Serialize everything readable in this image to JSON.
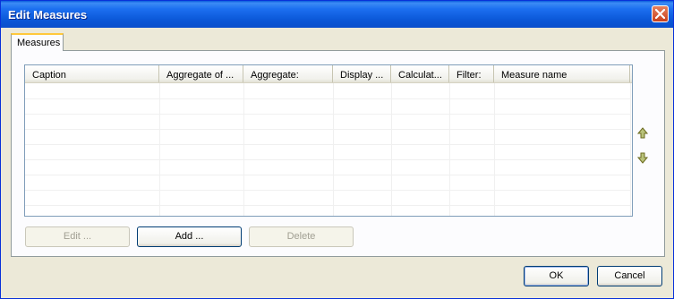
{
  "window": {
    "title": "Edit Measures"
  },
  "tabs": [
    {
      "label": "Measures"
    }
  ],
  "grid": {
    "columns": [
      "Caption",
      "Aggregate of ...",
      "Aggregate:",
      "Display ...",
      "Calculat...",
      "Filter:",
      "Measure name"
    ],
    "rows": []
  },
  "buttons": {
    "edit": "Edit ...",
    "add": "Add ...",
    "delete": "Delete",
    "ok": "OK",
    "cancel": "Cancel"
  },
  "icons": {
    "close": "close-icon",
    "up": "arrow-up-icon",
    "down": "arrow-down-icon"
  },
  "colors": {
    "titlebar": "#0a5ddc",
    "arrow": "#8a8a2a",
    "tab_highlight": "#ffc83c"
  }
}
